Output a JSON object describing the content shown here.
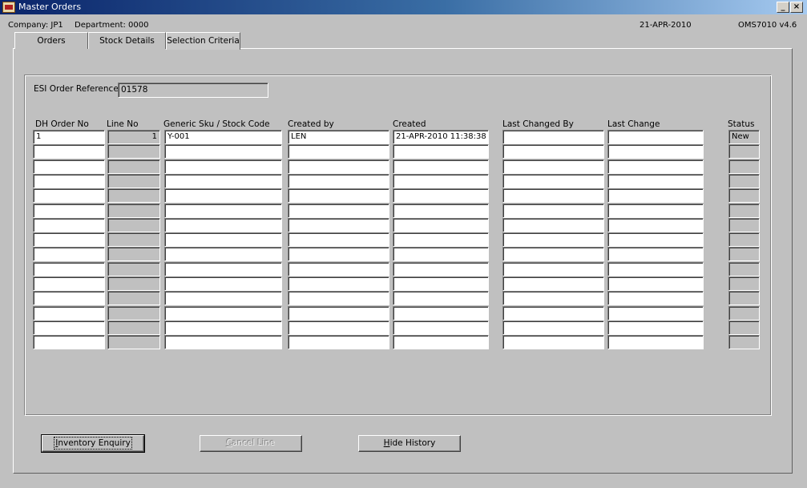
{
  "window": {
    "title": "Master Orders",
    "minimize_glyph": "_",
    "close_glyph": "×"
  },
  "info": {
    "company": "Company:  JP1",
    "department": "Department:  0000",
    "date": "21-APR-2010",
    "version": "OMS7010  v4.6"
  },
  "tabs": [
    {
      "label": "Orders"
    },
    {
      "label": "Stock Details"
    },
    {
      "label": "Selection Criteria",
      "active": true
    }
  ],
  "reference": {
    "label": "ESI Order Reference",
    "value": "01578"
  },
  "columns": [
    "DH Order No",
    "Line No",
    "Generic Sku / Stock Code",
    "Created by",
    "Created",
    "Last Changed By",
    "Last Change",
    "Status"
  ],
  "rows": [
    [
      "1",
      "1",
      "Y-001",
      "LEN",
      "21-APR-2010 11:38:38",
      "",
      "",
      "New"
    ],
    [
      "",
      "",
      "",
      "",
      "",
      "",
      "",
      ""
    ],
    [
      "",
      "",
      "",
      "",
      "",
      "",
      "",
      ""
    ],
    [
      "",
      "",
      "",
      "",
      "",
      "",
      "",
      ""
    ],
    [
      "",
      "",
      "",
      "",
      "",
      "",
      "",
      ""
    ],
    [
      "",
      "",
      "",
      "",
      "",
      "",
      "",
      ""
    ],
    [
      "",
      "",
      "",
      "",
      "",
      "",
      "",
      ""
    ],
    [
      "",
      "",
      "",
      "",
      "",
      "",
      "",
      ""
    ],
    [
      "",
      "",
      "",
      "",
      "",
      "",
      "",
      ""
    ],
    [
      "",
      "",
      "",
      "",
      "",
      "",
      "",
      ""
    ],
    [
      "",
      "",
      "",
      "",
      "",
      "",
      "",
      ""
    ],
    [
      "",
      "",
      "",
      "",
      "",
      "",
      "",
      ""
    ],
    [
      "",
      "",
      "",
      "",
      "",
      "",
      "",
      ""
    ],
    [
      "",
      "",
      "",
      "",
      "",
      "",
      "",
      ""
    ],
    [
      "",
      "",
      "",
      "",
      "",
      "",
      "",
      ""
    ]
  ],
  "buttons": {
    "inventory": {
      "mnemonic": "I",
      "rest": "nventory Enquiry"
    },
    "cancel": {
      "mnemonic": "C",
      "rest": "ancel Line",
      "disabled": true
    },
    "history": {
      "mnemonic": "H",
      "rest": "ide History"
    }
  }
}
